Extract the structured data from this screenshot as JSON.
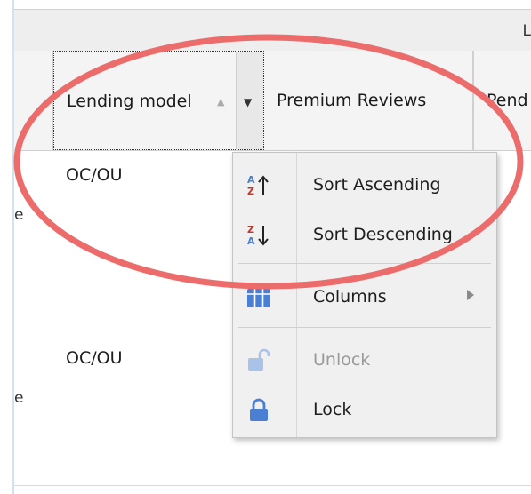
{
  "header": {
    "top_label": "L",
    "columns": [
      {
        "label": ""
      },
      {
        "label": "Lending model"
      },
      {
        "label": "Premium Reviews"
      },
      {
        "label": "Pend"
      }
    ]
  },
  "rows": [
    {
      "first": "e",
      "lending_model": "OC/OU"
    },
    {
      "first": "e",
      "lending_model": "OC/OU"
    }
  ],
  "menu": {
    "items": [
      {
        "label": "Sort Ascending",
        "icon": "sort-az-icon",
        "enabled": true
      },
      {
        "label": "Sort Descending",
        "icon": "sort-za-icon",
        "enabled": true
      },
      {
        "label": "Columns",
        "icon": "columns-grid-icon",
        "enabled": true,
        "has_submenu": true
      },
      {
        "label": "Unlock",
        "icon": "unlock-icon",
        "enabled": false
      },
      {
        "label": "Lock",
        "icon": "lock-icon",
        "enabled": true
      }
    ]
  },
  "colors": {
    "annotation_ring": "#ec6b6b",
    "icon_blue": "#4a7fd4",
    "icon_disabled": "#a9c2e8"
  }
}
